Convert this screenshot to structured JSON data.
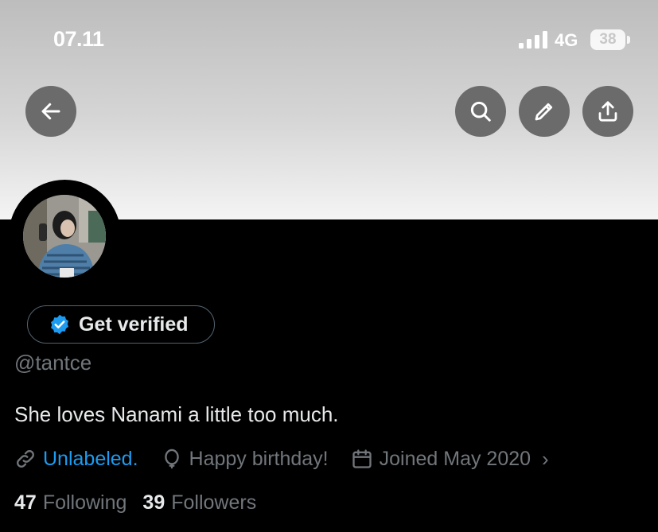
{
  "status_bar": {
    "time": "07.11",
    "network": "4G",
    "battery": "38"
  },
  "header": {
    "back_icon": "arrow-left-icon",
    "search_icon": "search-icon",
    "edit_icon": "pencil-icon",
    "share_icon": "share-icon"
  },
  "profile": {
    "get_verified_label": "Get verified",
    "handle": "@tantce",
    "bio": "She loves Nanami a little too much.",
    "link_text": "Unlabeled.",
    "birthday_text": "Happy birthday!",
    "joined_text": "Joined May 2020",
    "following_count": "47",
    "following_label": "Following",
    "followers_count": "39",
    "followers_label": "Followers"
  },
  "colors": {
    "accent": "#1d9bf0",
    "muted": "#71767b",
    "text": "#e7e9ea",
    "background": "#000000"
  }
}
